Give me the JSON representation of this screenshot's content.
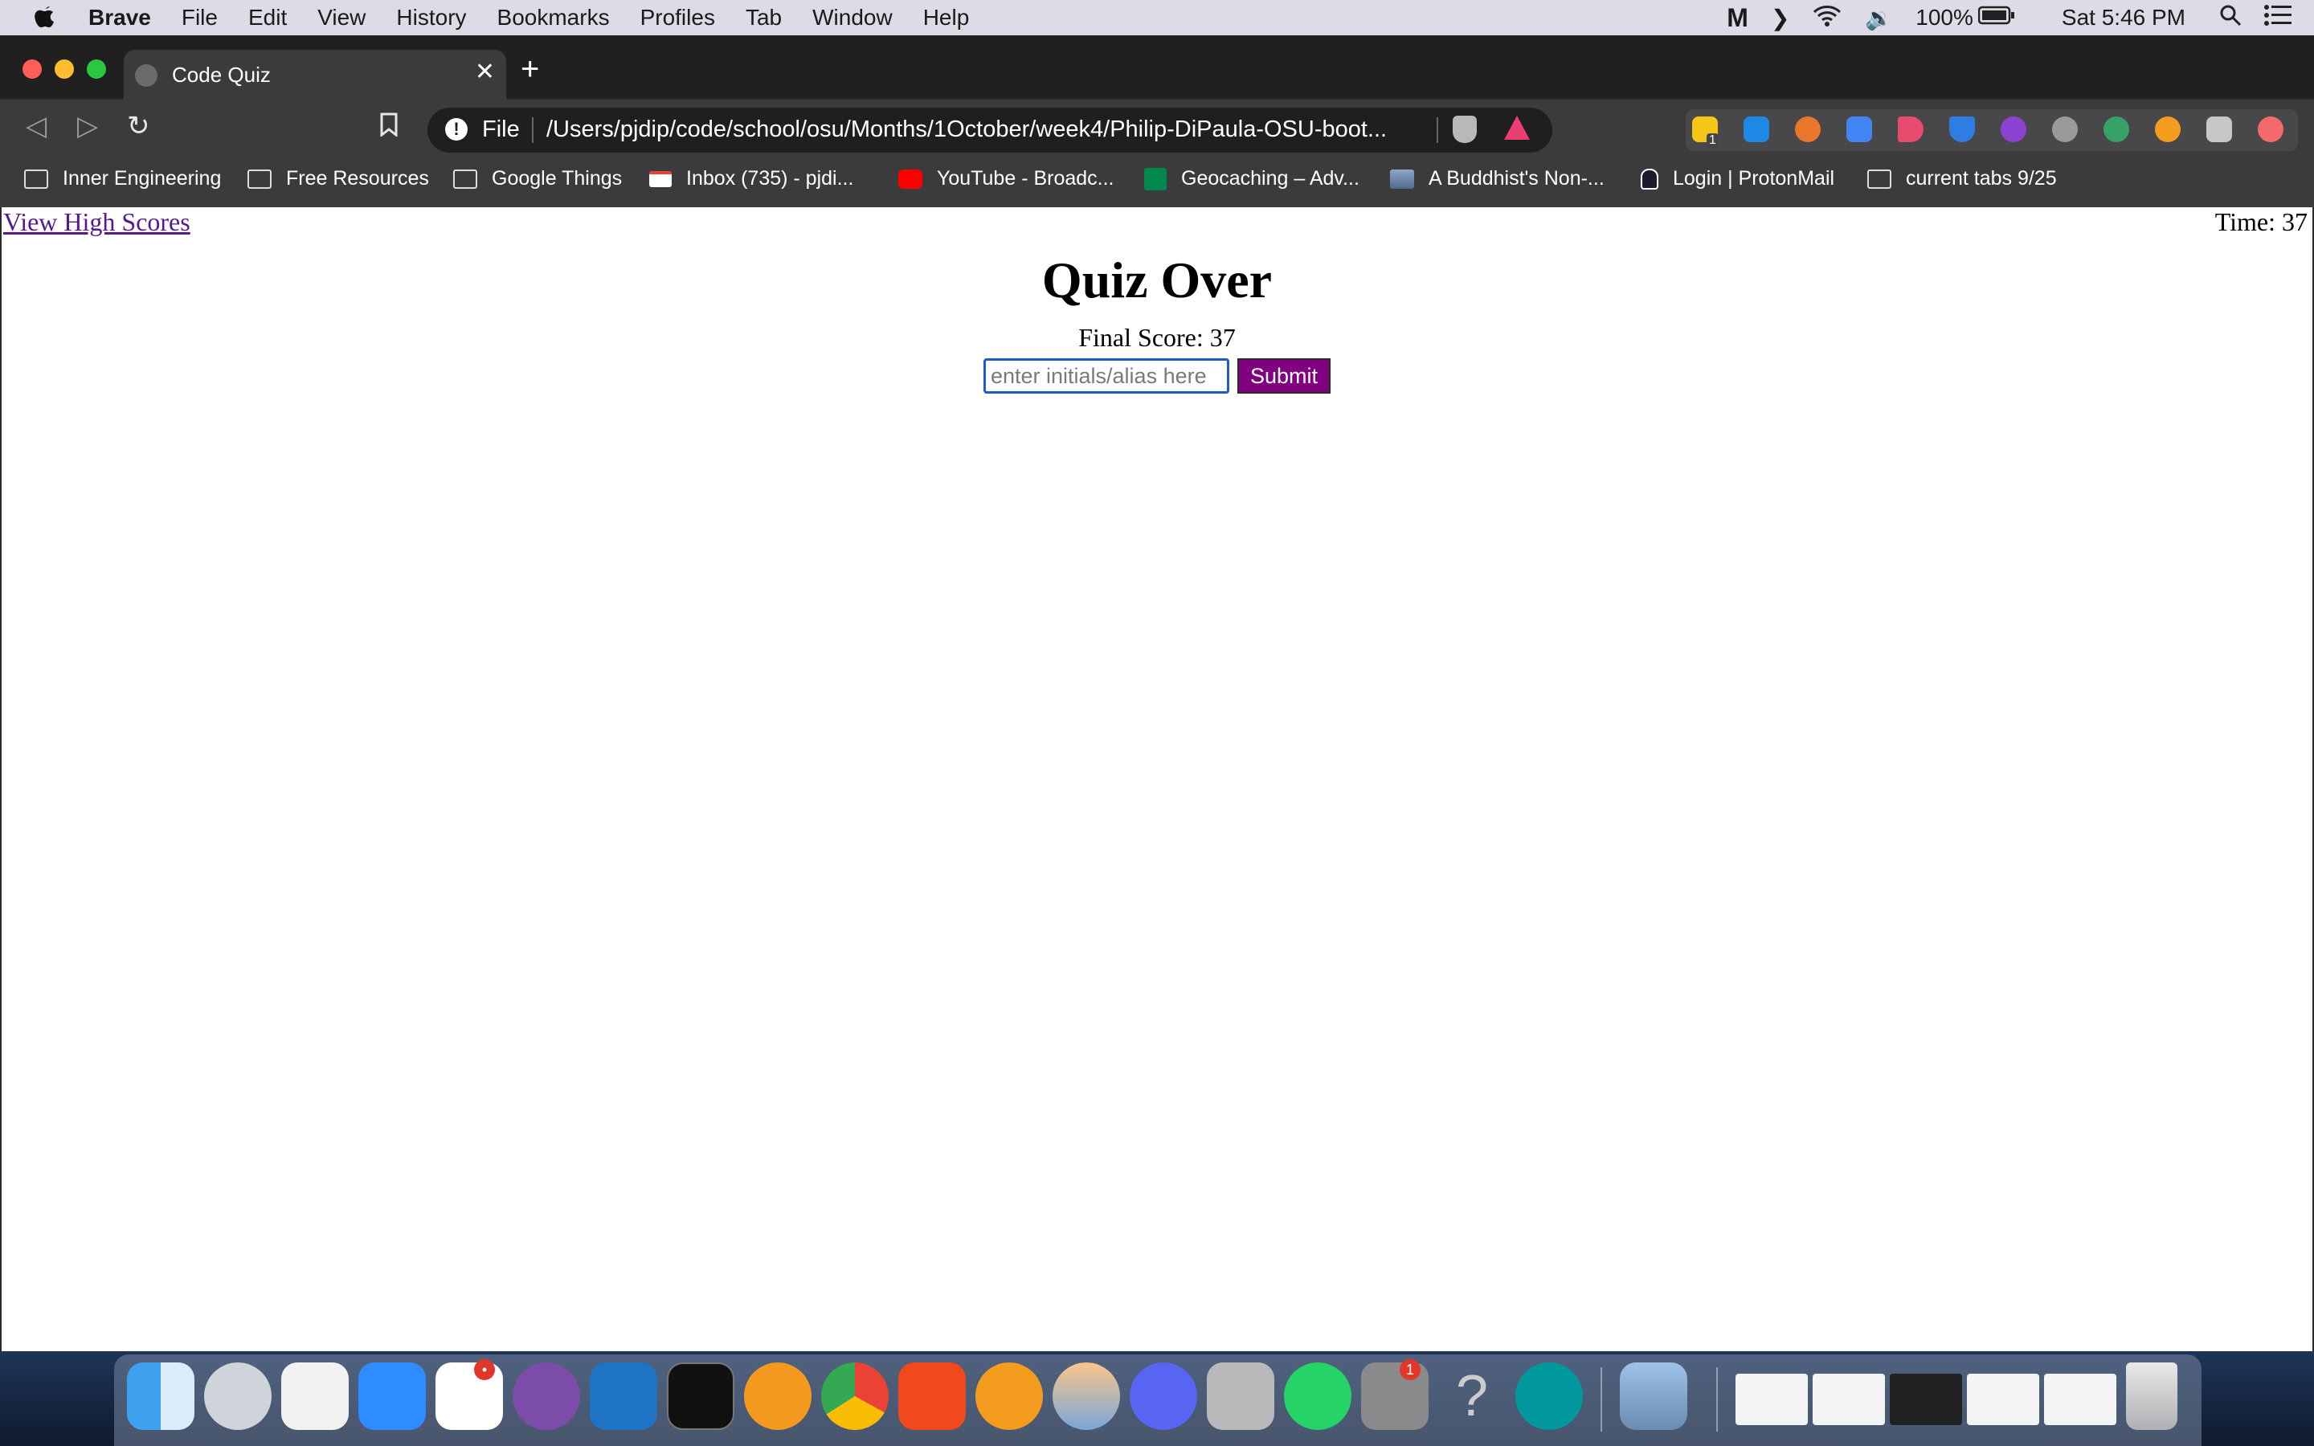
{
  "menubar": {
    "app": "Brave",
    "items": [
      "File",
      "Edit",
      "View",
      "History",
      "Bookmarks",
      "Profiles",
      "Tab",
      "Window",
      "Help"
    ],
    "battery": "100%",
    "clock": "Sat 5:46 PM"
  },
  "tab": {
    "title": "Code Quiz"
  },
  "address": {
    "scheme": "File",
    "path": "/Users/pjdip/code/school/osu/Months/1October/week4/Philip-DiPaula-OSU-boot..."
  },
  "bookmarks": [
    "Inner Engineering",
    "Free Resources",
    "Google Things",
    "Inbox (735) - pjdi...",
    "YouTube - Broadc...",
    "Geocaching – Adv...",
    "A Buddhist's Non-...",
    "Login | ProtonMail",
    "current tabs 9/25"
  ],
  "page": {
    "high_scores_link": "View High Scores",
    "timer": "Time: 37",
    "heading": "Quiz Over",
    "final_score": "Final Score: 37",
    "initials_placeholder": "enter initials/alias here",
    "submit_label": "Submit"
  },
  "extensions": {
    "badge": "1"
  },
  "dock": {
    "slack_badge": "•",
    "prefs_badge": "1"
  },
  "colors": {
    "link": "#551a8b",
    "submit_bg": "#800080",
    "input_focus": "#1e5dc8"
  }
}
